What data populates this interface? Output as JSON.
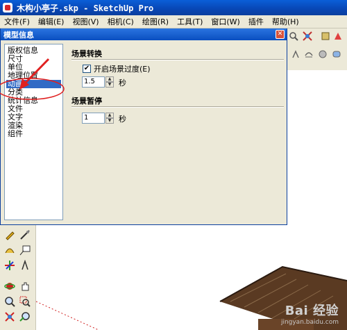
{
  "window": {
    "title": "木构小亭子.skp - SketchUp Pro"
  },
  "menubar": [
    "文件(F)",
    "编辑(E)",
    "视图(V)",
    "相机(C)",
    "绘图(R)",
    "工具(T)",
    "窗口(W)",
    "插件",
    "帮助(H)"
  ],
  "dialog": {
    "title": "模型信息",
    "categories": [
      "版权信息",
      "尺寸",
      "单位",
      "地理位置",
      "动画",
      "分类",
      "统计信息",
      "文件",
      "文字",
      "渲染",
      "组件"
    ],
    "selected_category": "动画",
    "scene_transition": {
      "heading": "场景转换",
      "checkbox_label": "开启场景过度(E)",
      "checked": true,
      "value": "1.5",
      "unit": "秒"
    },
    "scene_delay": {
      "heading": "场景暂停",
      "value": "1",
      "unit": "秒"
    }
  },
  "watermark": {
    "main": "Bai 经验",
    "sub": "jingyan.baidu.com"
  },
  "colors": {
    "title_bar": "#0846b4",
    "selection": "#316ac5",
    "annotation": "#e02020"
  },
  "icons": [
    "search-icon",
    "zoom-extents-icon",
    "pencil-icon",
    "tape-measure-icon",
    "protractor-icon",
    "text-icon",
    "axes-icon",
    "dimension-icon",
    "orbit-icon",
    "pan-icon",
    "zoom-icon",
    "zoom-window-icon"
  ]
}
